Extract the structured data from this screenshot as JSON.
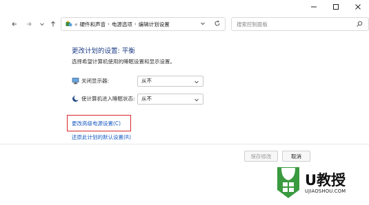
{
  "window": {
    "minimize_glyph": "—",
    "maximize_glyph": "☐",
    "close_glyph": "✕"
  },
  "nav": {
    "breadcrumb_root": "«",
    "breadcrumbs": [
      "硬件和声音",
      "电源选项",
      "编辑计划设置"
    ],
    "separator": "›",
    "search_placeholder": "搜索控制面板"
  },
  "main": {
    "title": "更改计划的设置: 平衡",
    "subtitle": "选择希望计算机使用的睡眠设置和显示设置。",
    "settings": [
      {
        "label": "关闭显示器:",
        "value": "从不",
        "icon": "monitor-icon"
      },
      {
        "label": "使计算机进入睡眠状态:",
        "value": "从不",
        "icon": "moon-icon"
      }
    ],
    "advanced_link": "更改高级电源设置(C)",
    "restore_link": "还原此计划的默认设置(R)"
  },
  "footer": {
    "save_label": "保存修改",
    "cancel_label": "取消"
  },
  "watermark": {
    "title": "U教授",
    "subtitle": "UJIAOSHOU.COM"
  },
  "colors": {
    "title_blue": "#1f3d86",
    "link_blue": "#1a5dc4",
    "highlight_red": "#d8262a",
    "watermark_green": "#3a9a3f"
  }
}
